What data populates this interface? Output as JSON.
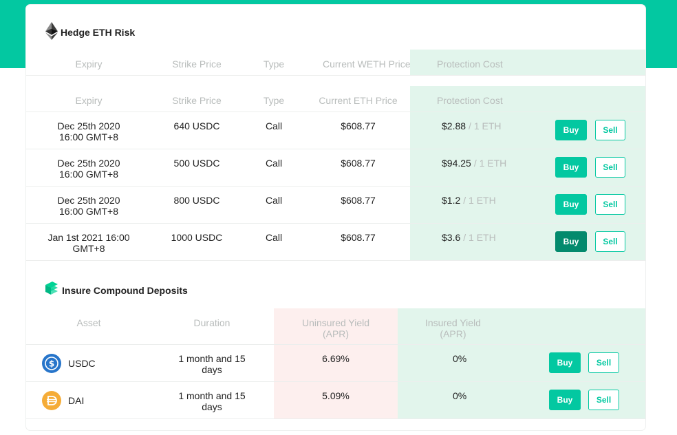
{
  "colors": {
    "accent": "#03c8a1",
    "accent_dark": "#038a6d",
    "green_bg": "#e2f5ec",
    "pink_bg": "#fdefee"
  },
  "hedge": {
    "title": "Hedge ETH Risk",
    "icon": "ethereum-icon",
    "sticky_headers": [
      "Expiry",
      "Strike Price",
      "Type",
      "Current WETH Price",
      "Protection Cost"
    ],
    "headers": [
      "Expiry",
      "Strike Price",
      "Type",
      "Current ETH Price",
      "Protection Cost"
    ],
    "rows": [
      {
        "expiry": "Dec 25th 2020\n16:00 GMT+8",
        "strike": "640 USDC",
        "type": "Call",
        "price": "$608.77",
        "cost": "$2.88",
        "cost_unit": "/ 1 ETH",
        "buy": "Buy",
        "sell": "Sell"
      },
      {
        "expiry": "Dec 25th 2020\n16:00 GMT+8",
        "strike": "500 USDC",
        "type": "Call",
        "price": "$608.77",
        "cost": "$94.25",
        "cost_unit": "/ 1 ETH",
        "buy": "Buy",
        "sell": "Sell"
      },
      {
        "expiry": "Dec 25th 2020\n16:00 GMT+8",
        "strike": "800 USDC",
        "type": "Call",
        "price": "$608.77",
        "cost": "$1.2",
        "cost_unit": "/ 1 ETH",
        "buy": "Buy",
        "sell": "Sell"
      },
      {
        "expiry": "Jan 1st 2021 16:00\nGMT+8",
        "strike": "1000 USDC",
        "type": "Call",
        "price": "$608.77",
        "cost": "$3.6",
        "cost_unit": "/ 1 ETH",
        "buy": "Buy",
        "sell": "Sell"
      }
    ]
  },
  "compound": {
    "title": "Insure Compound Deposits",
    "icon": "compound-icon",
    "headers": [
      "Asset",
      "Duration",
      "Uninsured Yield\n(APR)",
      "Insured Yield\n(APR)"
    ],
    "rows": [
      {
        "asset": "USDC",
        "icon": "usdc-icon",
        "duration": "1 month and 15\ndays",
        "uninsured": "6.69%",
        "insured": "0%",
        "buy": "Buy",
        "sell": "Sell"
      },
      {
        "asset": "DAI",
        "icon": "dai-icon",
        "duration": "1 month and 15\ndays",
        "uninsured": "5.09%",
        "insured": "0%",
        "buy": "Buy",
        "sell": "Sell"
      }
    ]
  }
}
